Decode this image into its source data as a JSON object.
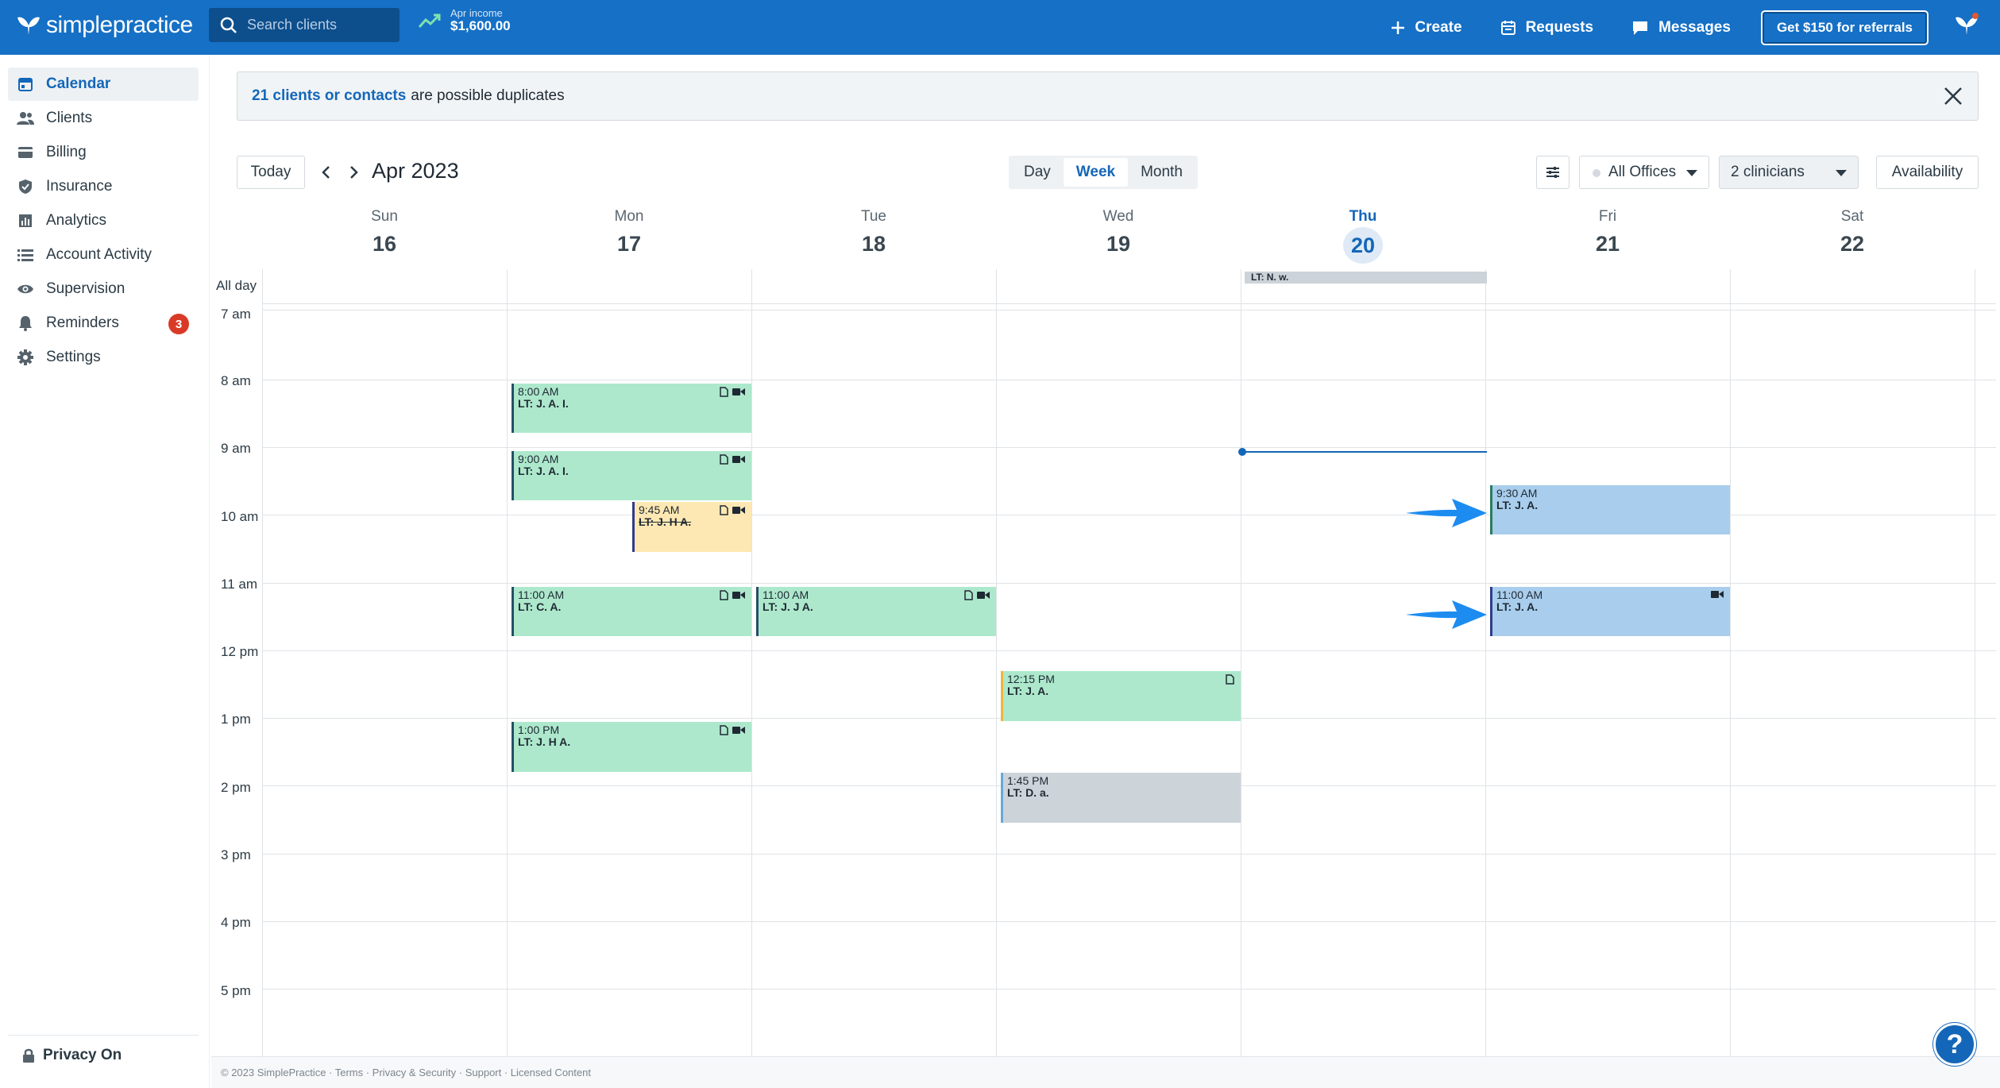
{
  "header": {
    "brand": "simplepractice",
    "search_placeholder": "Search clients",
    "income_label": "Apr income",
    "income_value": "$1,600.00",
    "create_label": "Create",
    "requests_label": "Requests",
    "messages_label": "Messages",
    "referral_label": "Get $150 for referrals"
  },
  "sidebar": {
    "items": [
      {
        "label": "Calendar"
      },
      {
        "label": "Clients"
      },
      {
        "label": "Billing"
      },
      {
        "label": "Insurance"
      },
      {
        "label": "Analytics"
      },
      {
        "label": "Account Activity"
      },
      {
        "label": "Supervision"
      },
      {
        "label": "Reminders",
        "badge": "3"
      },
      {
        "label": "Settings"
      }
    ],
    "privacy_label": "Privacy On"
  },
  "banner": {
    "link_text": "21 clients or contacts",
    "rest_text": "are possible duplicates"
  },
  "toolbar": {
    "today_label": "Today",
    "month_title": "Apr 2023",
    "views": [
      "Day",
      "Week",
      "Month"
    ],
    "active_view": "Week",
    "offices_label": "All Offices",
    "clinicians_label": "2 clinicians",
    "availability_label": "Availability"
  },
  "calendar": {
    "days": [
      {
        "name": "Sun",
        "date": "16"
      },
      {
        "name": "Mon",
        "date": "17"
      },
      {
        "name": "Tue",
        "date": "18"
      },
      {
        "name": "Wed",
        "date": "19"
      },
      {
        "name": "Thu",
        "date": "20"
      },
      {
        "name": "Fri",
        "date": "21"
      },
      {
        "name": "Sat",
        "date": "22"
      }
    ],
    "today": "Thu",
    "allday_label": "All day",
    "times": [
      "7 am",
      "8 am",
      "9 am",
      "10 am",
      "11 am",
      "12 pm",
      "1 pm",
      "2 pm",
      "3 pm",
      "4 pm",
      "5 pm"
    ],
    "allday_event": "LT: N. w.",
    "events": [
      {
        "time": "8:00 AM",
        "name": "LT: J. A. I."
      },
      {
        "time": "9:00 AM",
        "name": "LT: J. A. I."
      },
      {
        "time": "9:45 AM",
        "name": "LT: J. H A."
      },
      {
        "time": "11:00 AM",
        "name": "LT: C. A."
      },
      {
        "time": "11:00 AM",
        "name": "LT: J. J A."
      },
      {
        "time": "12:15 PM",
        "name": "LT: J. A."
      },
      {
        "time": "1:00 PM",
        "name": "LT: J. H A."
      },
      {
        "time": "1:45 PM",
        "name": "LT: D. a."
      },
      {
        "time": "9:30 AM",
        "name": "LT: J. A."
      },
      {
        "time": "11:00 AM",
        "name": "LT: J. A."
      }
    ]
  },
  "footer": {
    "text": "© 2023 SimplePractice · Terms · Privacy & Security · Support · Licensed Content"
  },
  "help_label": "?"
}
